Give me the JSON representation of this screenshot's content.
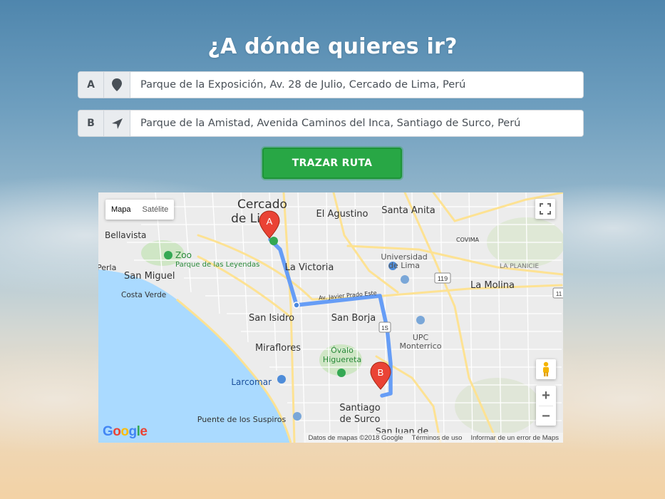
{
  "page": {
    "title": "¿A dónde quieres ir?"
  },
  "origin": {
    "letter": "A",
    "icon": "map-marker-icon",
    "value": "Parque de la Exposición, Av. 28 de Julio, Cercado de Lima, Perú"
  },
  "destination": {
    "letter": "B",
    "icon": "location-arrow-icon",
    "value": "Parque de la Amistad, Avenida Caminos del Inca, Santiago de Surco, Perú"
  },
  "route_button": {
    "label": "TRAZAR RUTA"
  },
  "map": {
    "types": {
      "map": "Mapa",
      "satellite": "Satélite"
    },
    "markers": {
      "a": "A",
      "b": "B"
    },
    "labels": {
      "cercado": "Cercado",
      "de_lima": "de Lima",
      "el_agustino": "El Agustino",
      "santa_anita": "Santa Anita",
      "bellavista": "Bellavista",
      "zoo": "Zoo",
      "parque_leyendas": "Parque de las Leyendas",
      "covima": "COVIMA",
      "universidad": "Universidad",
      "de_lima_univ": "de Lima",
      "perla": "Perla",
      "la_victoria": "La Victoria",
      "la_planicie": "LA PLANICIE",
      "san_miguel": "San Miguel",
      "costa_verde": "Costa Verde",
      "la_molina": "La Molina",
      "javier_prado": "Av. Javier Prado Este",
      "san_isidro": "San Isidro",
      "san_borja": "San Borja",
      "upc": "UPC",
      "monterrico": "Monterrico",
      "miraflores": "Miraflores",
      "ovalo": "Óvalo",
      "higuereta": "Higuereta",
      "larcomar": "Larcomar",
      "santiago": "Santiago",
      "de_surco": "de Surco",
      "puente": "Puente de los Suspiros",
      "san_juan": "San Juan de",
      "road_119": "119",
      "road_1s": "1S",
      "road_11": "11"
    },
    "footer": {
      "data": "Datos de mapas ©2018 Google",
      "terms": "Términos de uso",
      "report": "Informar de un error de Maps"
    },
    "logo": "Google",
    "zoom_in": "+",
    "zoom_out": "−"
  }
}
